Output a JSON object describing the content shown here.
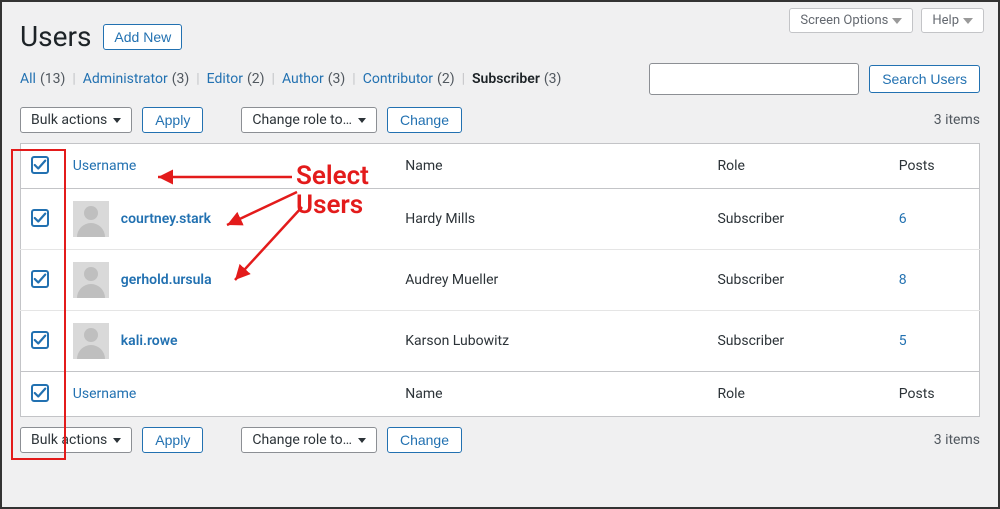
{
  "topButtons": {
    "screenOptions": "Screen Options",
    "help": "Help"
  },
  "header": {
    "title": "Users",
    "addNew": "Add New"
  },
  "filters": {
    "items": [
      {
        "label": "All",
        "count": "(13)"
      },
      {
        "label": "Administrator",
        "count": "(3)"
      },
      {
        "label": "Editor",
        "count": "(2)"
      },
      {
        "label": "Author",
        "count": "(3)"
      },
      {
        "label": "Contributor",
        "count": "(2)"
      },
      {
        "label": "Subscriber",
        "count": "(3)",
        "current": true
      }
    ],
    "search": {
      "placeholder": "",
      "button": "Search Users"
    }
  },
  "actions": {
    "bulk": "Bulk actions",
    "apply": "Apply",
    "changeRole": "Change role to…",
    "change": "Change",
    "itemsCount": "3 items"
  },
  "columns": {
    "username": "Username",
    "name": "Name",
    "role": "Role",
    "posts": "Posts"
  },
  "rows": [
    {
      "username": "courtney.stark",
      "name": "Hardy Mills",
      "role": "Subscriber",
      "posts": "6"
    },
    {
      "username": "gerhold.ursula",
      "name": "Audrey Mueller",
      "role": "Subscriber",
      "posts": "8"
    },
    {
      "username": "kali.rowe",
      "name": "Karson Lubowitz",
      "role": "Subscriber",
      "posts": "5"
    }
  ],
  "annotation": {
    "text": "Select\nUsers"
  }
}
